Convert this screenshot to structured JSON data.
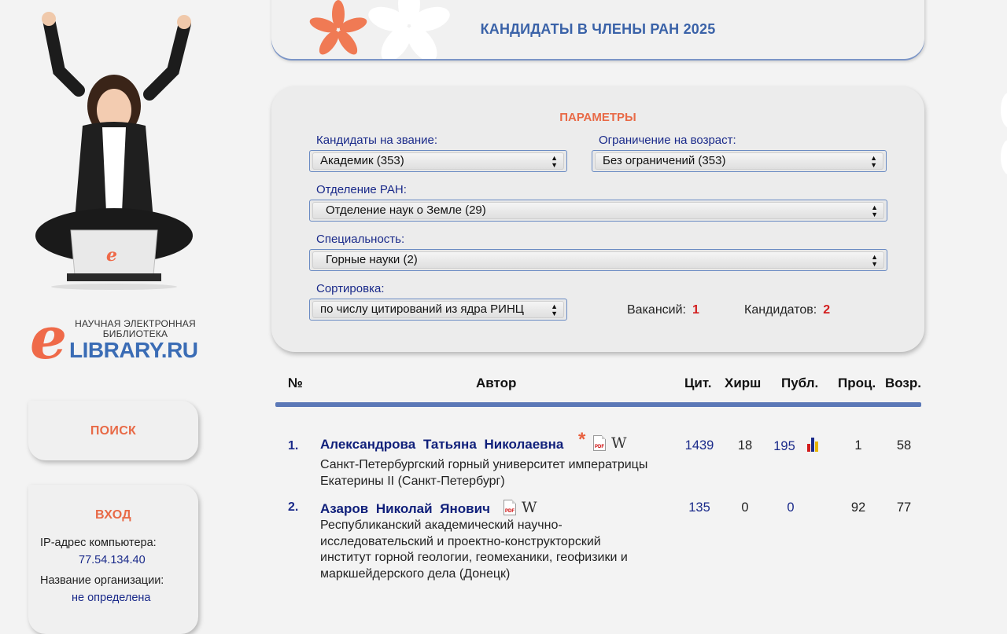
{
  "sidebar": {
    "logo_tagline": "НАУЧНАЯ ЭЛЕКТРОННАЯ БИБЛИОТЕКА",
    "logo_brand": "LIBRARY.RU",
    "search_label": "ПОИСК",
    "login": {
      "title": "ВХОД",
      "ip_label": "IP-адрес компьютера:",
      "ip_value": "77.54.134.40",
      "org_label": "Название организации:",
      "org_value": "не определена"
    }
  },
  "banner": {
    "title": "КАНДИДАТЫ В ЧЛЕНЫ РАН 2025"
  },
  "params": {
    "title": "ПАРАМЕТРЫ",
    "rank_label": "Кандидаты на звание:",
    "rank_value": "Академик  (353)",
    "age_label": "Ограничение на возраст:",
    "age_value": "Без ограничений  (353)",
    "dept_label": "Отделение РАН:",
    "dept_value": "Отделение наук о Земле  (29)",
    "spec_label": "Специальность:",
    "spec_value": "Горные науки  (2)",
    "sort_label": "Сортировка:",
    "sort_value": "по числу цитирований из ядра РИНЦ",
    "vacancies_label": "Вакансий:",
    "vacancies_value": "1",
    "candidates_label": "Кандидатов:",
    "candidates_value": "2"
  },
  "table": {
    "headers": {
      "num": "№",
      "author": "Автор",
      "cit": "Цит.",
      "hirsch": "Хирш",
      "publ": "Публ.",
      "proc": "Проц.",
      "age": "Возр."
    },
    "rows": [
      {
        "num": "1.",
        "author": "Александрова Татьяна Николаевна",
        "org_line1": "Санкт-Петербургский горный университет императрицы",
        "org_line2": "Екатерины II (Санкт-Петербург)",
        "cit": "1439",
        "hirsch": "18",
        "publ": "195",
        "proc": "1",
        "age": "58"
      },
      {
        "num": "2.",
        "author": "Азаров Николай Янович",
        "org_line1": "Республиканский академический научно-",
        "org_line2": "исследовательский и проектно-конструкторский",
        "org_line3": "институт горной геологии, геомеханики, геофизики и",
        "org_line4": "маркшейдерского дела (Донецк)",
        "cit": "135",
        "hirsch": "0",
        "publ": "0",
        "proc": "92",
        "age": "77"
      }
    ]
  },
  "colors": {
    "accent_orange": "#e86a47",
    "link_blue": "#1a2a8a",
    "rule_blue": "#5b78b7"
  }
}
